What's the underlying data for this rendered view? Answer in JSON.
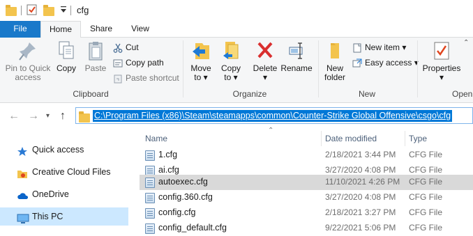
{
  "window": {
    "title": "cfg"
  },
  "tabs": [
    {
      "label": "File"
    },
    {
      "label": "Home"
    },
    {
      "label": "Share"
    },
    {
      "label": "View"
    }
  ],
  "ribbon": {
    "clipboard": {
      "pin_label_1": "Pin to Quick",
      "pin_label_2": "access",
      "copy_label": "Copy",
      "paste_label": "Paste",
      "cut_label": "Cut",
      "copy_path_label": "Copy path",
      "paste_shortcut_label": "Paste shortcut",
      "group_label": "Clipboard"
    },
    "organize": {
      "move_to_1": "Move",
      "move_to_2": "to",
      "copy_to_1": "Copy",
      "copy_to_2": "to",
      "delete_label": "Delete",
      "rename_label": "Rename",
      "group_label": "Organize"
    },
    "new": {
      "new_folder_1": "New",
      "new_folder_2": "folder",
      "new_item_label": "New item",
      "easy_access_label": "Easy access",
      "group_label": "New"
    },
    "open": {
      "properties_label": "Properties",
      "group_label": "Open"
    }
  },
  "address": {
    "path": "C:\\Program Files (x86)\\Steam\\steamapps\\common\\Counter-Strike Global Offensive\\csgo\\cfg"
  },
  "nav": {
    "items": [
      {
        "label": "Quick access",
        "icon": "star-icon"
      },
      {
        "label": "Creative Cloud Files",
        "icon": "creative-cloud-folder-icon"
      },
      {
        "label": "OneDrive",
        "icon": "cloud-icon"
      },
      {
        "label": "This PC",
        "icon": "monitor-icon"
      }
    ]
  },
  "columns": {
    "name": "Name",
    "date": "Date modified",
    "type": "Type"
  },
  "files": [
    {
      "name": "1.cfg",
      "date": "2/18/2021 3:44 PM",
      "type": "CFG File"
    },
    {
      "name": "ai.cfg",
      "date": "3/27/2020 4:08 PM",
      "type": "CFG File"
    },
    {
      "name": "autoexec.cfg",
      "date": "11/10/2021 4:26 PM",
      "type": "CFG File"
    },
    {
      "name": "config.360.cfg",
      "date": "3/27/2020 4:08 PM",
      "type": "CFG File"
    },
    {
      "name": "config.cfg",
      "date": "2/18/2021 3:27 PM",
      "type": "CFG File"
    },
    {
      "name": "config_default.cfg",
      "date": "9/22/2021 5:06 PM",
      "type": "CFG File"
    }
  ],
  "colors": {
    "accent": "#1979ca",
    "selection": "#0078d7",
    "row_selected": "#d9d9d9",
    "nav_selected": "#cce8ff"
  }
}
